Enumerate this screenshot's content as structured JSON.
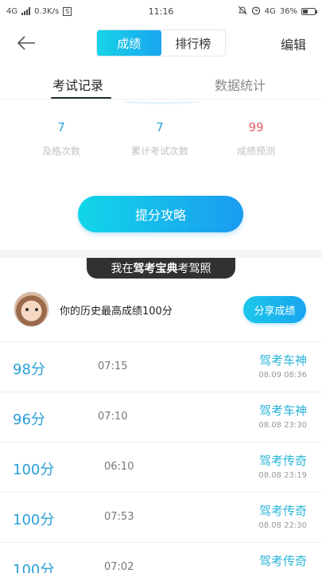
{
  "status_bar": {
    "network_left": "4G",
    "speed": "0.3K/s",
    "sim_box": "S",
    "time": "11:16",
    "network_right": "4G",
    "battery_pct": "36%"
  },
  "nav": {
    "tabs": [
      "成绩",
      "排行榜"
    ],
    "edit_label": "编辑"
  },
  "subtabs": {
    "records": "考试记录",
    "stats": "数据统计"
  },
  "stats": [
    {
      "value": "7",
      "label": "及格次数"
    },
    {
      "value": "7",
      "label": "累计考试次数"
    },
    {
      "value": "99",
      "label": "成绩预测"
    }
  ],
  "cta_label": "提分攻略",
  "banner": {
    "prefix": "我在",
    "brand": "驾考宝典",
    "suffix": "考驾照"
  },
  "profile": {
    "text": "你的历史最高成绩100分",
    "share_label": "分享成绩"
  },
  "records": [
    {
      "score": "98分",
      "duration": "07:15",
      "title": "驾考车神",
      "date": "08.09   08:36"
    },
    {
      "score": "96分",
      "duration": "07:10",
      "title": "驾考车神",
      "date": "08.08   23:30"
    },
    {
      "score": "100分",
      "duration": "06:10",
      "title": "驾考传奇",
      "date": "08.08   23:19"
    },
    {
      "score": "100分",
      "duration": "07:53",
      "title": "驾考传奇",
      "date": "08.08   22:30"
    },
    {
      "score": "100分",
      "duration": "07:02",
      "title": "驾考传奇",
      "date": ""
    }
  ],
  "colors": {
    "accent": "#1aa6f0",
    "accent_light": "#18d3e6",
    "prediction": "#e06060",
    "banner_bg": "#2f3133"
  }
}
